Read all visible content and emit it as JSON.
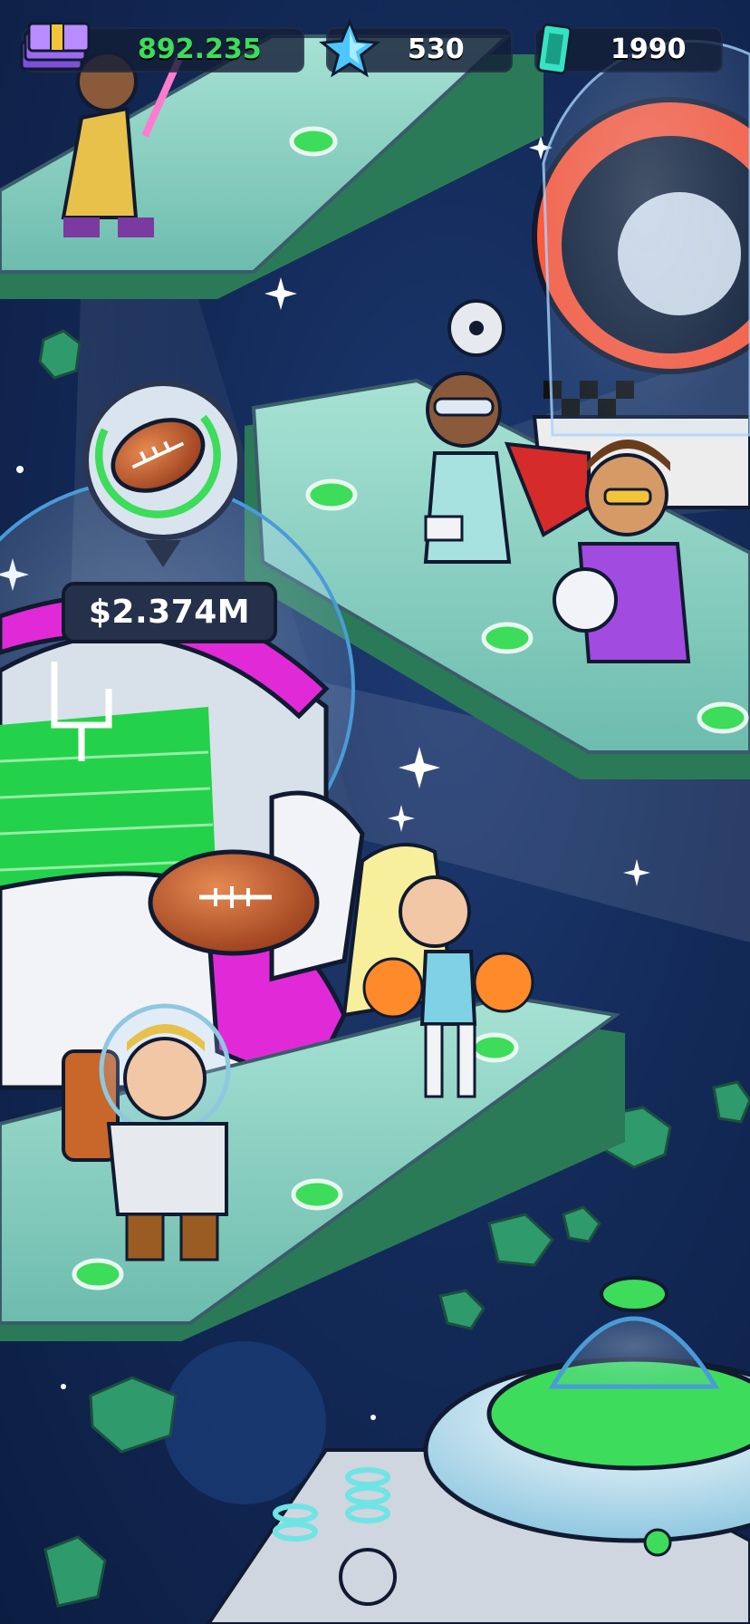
{
  "hud": {
    "cash": {
      "value": "892.235",
      "icon": "cash-stack-icon",
      "color": "#3ddc5a"
    },
    "gems": {
      "value": "530",
      "icon": "blue-star-gem-icon"
    },
    "tickets": {
      "value": "1990",
      "icon": "ticket-icon"
    }
  },
  "stadium": {
    "price_label": "$2.374M",
    "icon": "football-icon"
  },
  "colors": {
    "accent_green": "#3ddc5a",
    "space_bg": "#132a58",
    "platform": "#8fd3c5",
    "asteroid": "#2f9a6b"
  }
}
